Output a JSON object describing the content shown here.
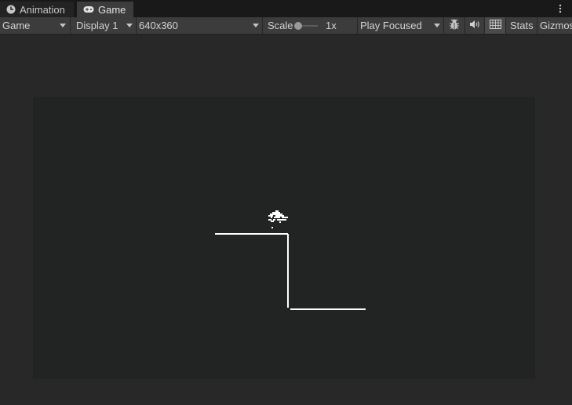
{
  "tabs": [
    {
      "label": "Animation",
      "icon": "clock-icon",
      "active": false
    },
    {
      "label": "Game",
      "icon": "gamepad-icon",
      "active": true
    }
  ],
  "toolbar": {
    "view_mode": "Game",
    "display": "Display 1",
    "resolution": "640x360",
    "scale_label": "Scale",
    "scale_value": "1x",
    "play_mode": "Play Focused",
    "stats_label": "Stats",
    "gizmos_label": "Gizmos"
  },
  "icons": {
    "bug": "bug-icon",
    "audio": "speaker-icon",
    "grid": "grid-icon",
    "more": "more-vertical-icon"
  },
  "colors": {
    "tab_bg": "#191919",
    "toolbar_bg": "#3c3c3c",
    "view_bg": "#282828",
    "canvas_bg": "#222423",
    "game_lines": "#ffffff"
  }
}
